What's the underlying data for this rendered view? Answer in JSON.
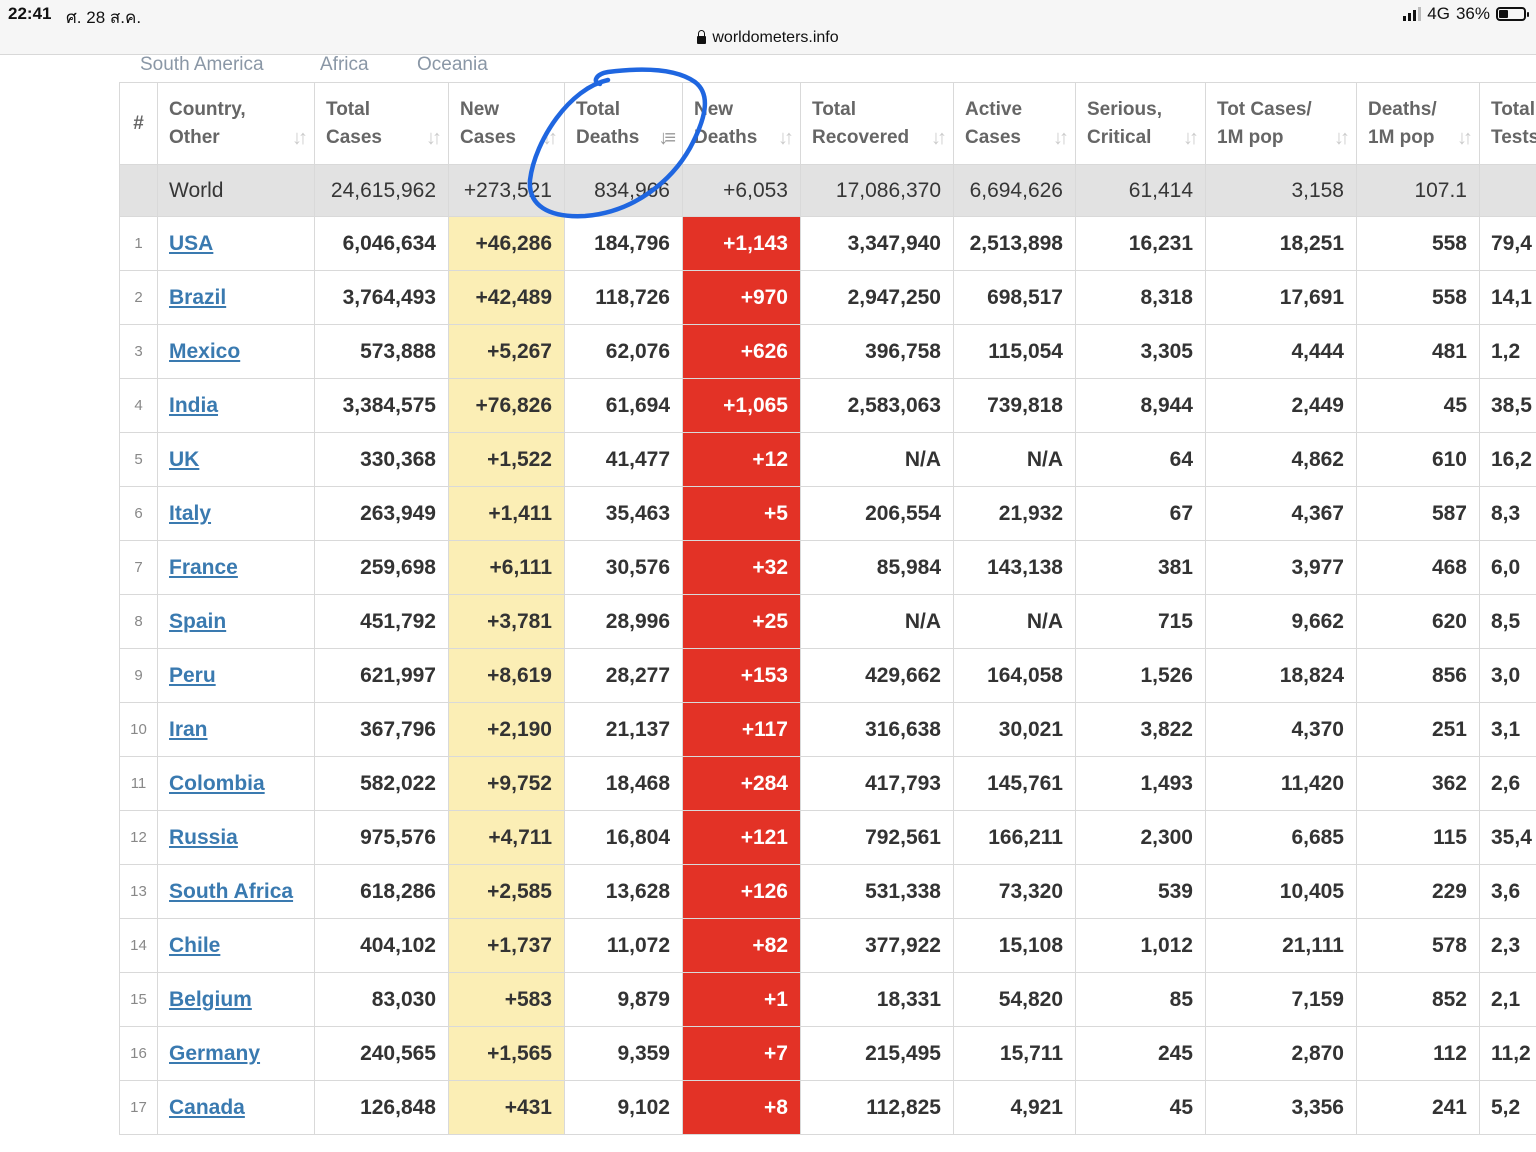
{
  "status": {
    "time": "22:41",
    "date": "ศ. 28 ส.ค.",
    "network": "4G",
    "battery": "36%"
  },
  "url": "worldometers.info",
  "tabs": [
    "South America",
    "Africa",
    "Oceania"
  ],
  "headers": {
    "num": "#",
    "country": [
      "Country,",
      "Other"
    ],
    "total_cases": [
      "Total",
      "Cases"
    ],
    "new_cases": [
      "New",
      "Cases"
    ],
    "total_deaths": [
      "Total",
      "Deaths"
    ],
    "new_deaths": [
      "New",
      "Deaths"
    ],
    "total_recovered": [
      "Total",
      "Recovered"
    ],
    "active_cases": [
      "Active",
      "Cases"
    ],
    "serious": [
      "Serious,",
      "Critical"
    ],
    "tot_cases_1m": [
      "Tot Cases/",
      "1M pop"
    ],
    "deaths_1m": [
      "Deaths/",
      "1M pop"
    ],
    "total_tests": [
      "Total",
      "Tests"
    ]
  },
  "world": {
    "name": "World",
    "total_cases": "24,615,962",
    "new_cases": "+273,521",
    "total_deaths": "834,966",
    "new_deaths": "+6,053",
    "total_recovered": "17,086,370",
    "active_cases": "6,694,626",
    "serious": "61,414",
    "tot_cases_1m": "3,158",
    "deaths_1m": "107.1",
    "total_tests": ""
  },
  "rows": [
    [
      "1",
      "USA",
      "6,046,634",
      "+46,286",
      "184,796",
      "+1,143",
      "3,347,940",
      "2,513,898",
      "16,231",
      "18,251",
      "558",
      "79,4"
    ],
    [
      "2",
      "Brazil",
      "3,764,493",
      "+42,489",
      "118,726",
      "+970",
      "2,947,250",
      "698,517",
      "8,318",
      "17,691",
      "558",
      "14,1"
    ],
    [
      "3",
      "Mexico",
      "573,888",
      "+5,267",
      "62,076",
      "+626",
      "396,758",
      "115,054",
      "3,305",
      "4,444",
      "481",
      "1,2"
    ],
    [
      "4",
      "India",
      "3,384,575",
      "+76,826",
      "61,694",
      "+1,065",
      "2,583,063",
      "739,818",
      "8,944",
      "2,449",
      "45",
      "38,5"
    ],
    [
      "5",
      "UK",
      "330,368",
      "+1,522",
      "41,477",
      "+12",
      "N/A",
      "N/A",
      "64",
      "4,862",
      "610",
      "16,2"
    ],
    [
      "6",
      "Italy",
      "263,949",
      "+1,411",
      "35,463",
      "+5",
      "206,554",
      "21,932",
      "67",
      "4,367",
      "587",
      "8,3"
    ],
    [
      "7",
      "France",
      "259,698",
      "+6,111",
      "30,576",
      "+32",
      "85,984",
      "143,138",
      "381",
      "3,977",
      "468",
      "6,0"
    ],
    [
      "8",
      "Spain",
      "451,792",
      "+3,781",
      "28,996",
      "+25",
      "N/A",
      "N/A",
      "715",
      "9,662",
      "620",
      "8,5"
    ],
    [
      "9",
      "Peru",
      "621,997",
      "+8,619",
      "28,277",
      "+153",
      "429,662",
      "164,058",
      "1,526",
      "18,824",
      "856",
      "3,0"
    ],
    [
      "10",
      "Iran",
      "367,796",
      "+2,190",
      "21,137",
      "+117",
      "316,638",
      "30,021",
      "3,822",
      "4,370",
      "251",
      "3,1"
    ],
    [
      "11",
      "Colombia",
      "582,022",
      "+9,752",
      "18,468",
      "+284",
      "417,793",
      "145,761",
      "1,493",
      "11,420",
      "362",
      "2,6"
    ],
    [
      "12",
      "Russia",
      "975,576",
      "+4,711",
      "16,804",
      "+121",
      "792,561",
      "166,211",
      "2,300",
      "6,685",
      "115",
      "35,4"
    ],
    [
      "13",
      "South Africa",
      "618,286",
      "+2,585",
      "13,628",
      "+126",
      "531,338",
      "73,320",
      "539",
      "10,405",
      "229",
      "3,6"
    ],
    [
      "14",
      "Chile",
      "404,102",
      "+1,737",
      "11,072",
      "+82",
      "377,922",
      "15,108",
      "1,012",
      "21,111",
      "578",
      "2,3"
    ],
    [
      "15",
      "Belgium",
      "83,030",
      "+583",
      "9,879",
      "+1",
      "18,331",
      "54,820",
      "85",
      "7,159",
      "852",
      "2,1"
    ],
    [
      "16",
      "Germany",
      "240,565",
      "+1,565",
      "9,359",
      "+7",
      "215,495",
      "15,711",
      "245",
      "2,870",
      "112",
      "11,2"
    ],
    [
      "17",
      "Canada",
      "126,848",
      "+431",
      "9,102",
      "+8",
      "112,825",
      "4,921",
      "45",
      "3,356",
      "241",
      "5,2"
    ]
  ]
}
